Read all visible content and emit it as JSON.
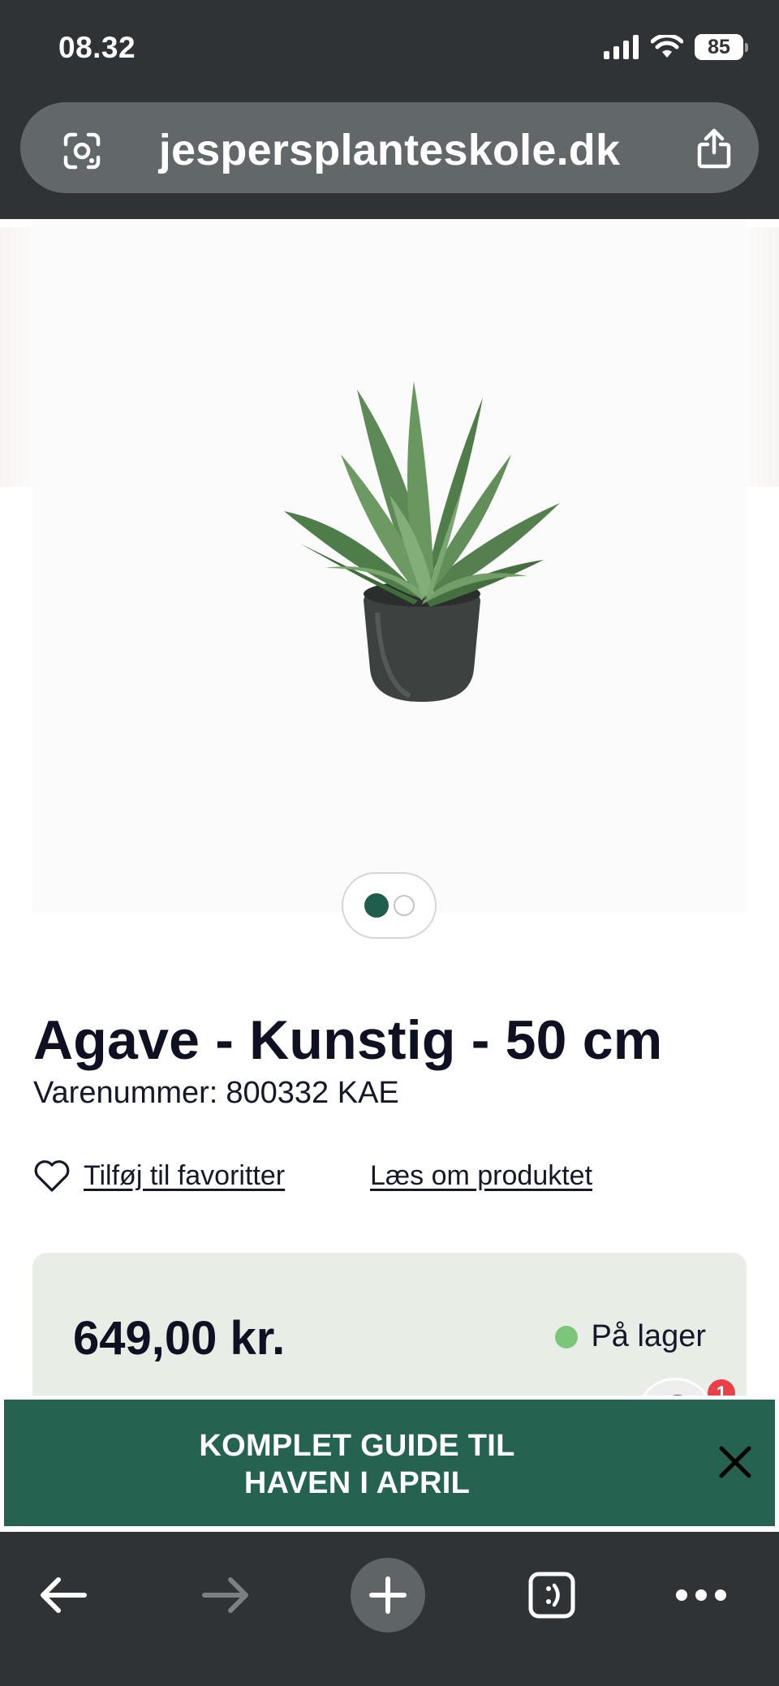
{
  "status_bar": {
    "time": "08.32",
    "battery": "85"
  },
  "browser": {
    "url": "jespersplanteskole.dk"
  },
  "gallery": {
    "total": 2,
    "active_index": 0
  },
  "product": {
    "title": "Agave - Kunstig - 50 cm",
    "sku_label": "Varenummer:",
    "sku_value": "800332 KAE",
    "favorite_label": "Tilføj til favoritter",
    "read_more_label": "Læs om produktet",
    "price": "649,00 kr.",
    "stock_status": "På lager"
  },
  "chat": {
    "badge_count": "1"
  },
  "promo": {
    "line1": "KOMPLET GUIDE TIL",
    "line2": "HAVEN I APRIL"
  },
  "colors": {
    "brand_green": "#256250",
    "stock_green": "#7dc57a",
    "chrome": "#2f3336"
  },
  "icons": [
    "scan-icon",
    "share-icon",
    "heart-icon",
    "close-icon",
    "back-arrow-icon",
    "forward-arrow-icon",
    "plus-icon",
    "tabs-icon",
    "more-icon"
  ]
}
